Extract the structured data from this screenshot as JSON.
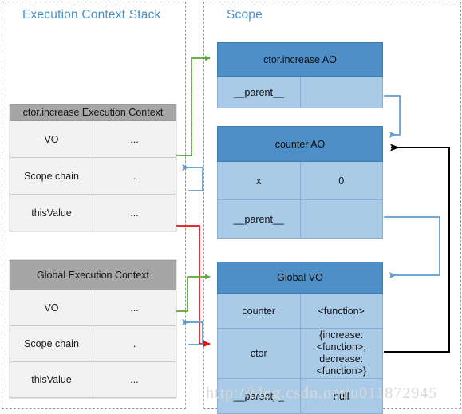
{
  "panels": {
    "left": {
      "title": "Execution Context Stack"
    },
    "right": {
      "title": "Scope"
    }
  },
  "execution_contexts": [
    {
      "id": "ctor-increase-ec",
      "header": "ctor.increase Execution Context",
      "rows": [
        {
          "key": "VO",
          "value": "..."
        },
        {
          "key": "Scope chain",
          "value": "."
        },
        {
          "key": "thisValue",
          "value": "..."
        }
      ]
    },
    {
      "id": "global-ec",
      "header": "Global Execution Context",
      "rows": [
        {
          "key": "VO",
          "value": "..."
        },
        {
          "key": "Scope chain",
          "value": "."
        },
        {
          "key": "thisValue",
          "value": "..."
        }
      ]
    }
  ],
  "scope_objects": [
    {
      "id": "ctor-increase-ao",
      "header": "ctor.increase AO",
      "rows": [
        {
          "key": "__parent__",
          "value": ""
        }
      ]
    },
    {
      "id": "counter-ao",
      "header": "counter AO",
      "rows": [
        {
          "key": "x",
          "value": "0"
        },
        {
          "key": "__parent__",
          "value": ""
        }
      ]
    },
    {
      "id": "global-vo",
      "header": "Global VO",
      "rows": [
        {
          "key": "counter",
          "value": "<function>"
        },
        {
          "key": "ctor",
          "value_line1": "{increase: <function>,",
          "value_line2": "decrease: <function>}"
        },
        {
          "key": "__parent__",
          "value": "null"
        }
      ]
    }
  ],
  "arrows": [
    {
      "name": "vo-to-increase-ao",
      "color": "#58a832",
      "from": "ctor.increase EC VO",
      "to": "ctor.increase AO"
    },
    {
      "name": "increase-ao-parent-to-counter-ao",
      "color": "#5b9bd5",
      "from": "ctor.increase AO __parent__",
      "to": "counter AO"
    },
    {
      "name": "scope-chain-to-increase-ao",
      "color": "#5b9bd5",
      "from": "ctor.increase EC Scope chain",
      "to": "ctor.increase AO"
    },
    {
      "name": "thisvalue-to-ctor",
      "color": "#e81010",
      "from": "ctor.increase EC thisValue",
      "to": "Global VO ctor"
    },
    {
      "name": "global-vo-to-global-ec",
      "color": "#58a832",
      "from": "Global EC VO",
      "to": "Global VO"
    },
    {
      "name": "global-scope-chain-to-global-vo",
      "color": "#5b9bd5",
      "from": "Global EC Scope chain",
      "to": "Global VO"
    },
    {
      "name": "counter-ao-parent-to-global-vo",
      "color": "#5b9bd5",
      "from": "counter AO __parent__",
      "to": "Global VO"
    },
    {
      "name": "ctor-to-counter-ao",
      "color": "#000000",
      "from": "Global VO ctor",
      "to": "counter AO"
    }
  ],
  "watermark": "http://blog.csdn.net/u011872945",
  "colors": {
    "title": "#4a90c8",
    "ec_header": "#a6a6a6",
    "ec_row": "#f2f2f2",
    "ao_header": "#4e8fc8",
    "ao_row": "#a9cbe8",
    "green": "#58a832",
    "blue": "#5b9bd5",
    "red": "#e81010",
    "black": "#000000"
  }
}
